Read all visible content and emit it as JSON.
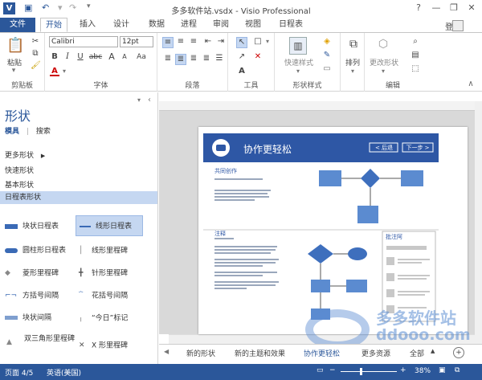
{
  "title_bar": {
    "app_icon": "V",
    "title": "多多软件站.vsdx - Visio Professional",
    "help": "?",
    "minimize": "—",
    "restore": "❐",
    "close": "✕"
  },
  "tabs": [
    {
      "label": "文件"
    },
    {
      "label": "开始"
    },
    {
      "label": "插入"
    },
    {
      "label": "设计"
    },
    {
      "label": "数据"
    },
    {
      "label": "进程"
    },
    {
      "label": "审阅"
    },
    {
      "label": "视图"
    },
    {
      "label": "日程表"
    }
  ],
  "login_label": "登录",
  "ribbon": {
    "clipboard": {
      "label": "剪贴板",
      "paste": "粘贴"
    },
    "font": {
      "label": "字体",
      "font_name": "Calibri",
      "font_size": "12pt"
    },
    "paragraph": {
      "label": "段落"
    },
    "tools": {
      "label": "工具"
    },
    "shape_styles": {
      "label": "形状样式",
      "quick_styles": "快速样式"
    },
    "arrange": {
      "label": "排列"
    },
    "edit": {
      "label": "编辑",
      "change_shape": "更改形状"
    }
  },
  "shapes_pane": {
    "title": "形状",
    "tab_stencils": "模具",
    "tab_search": "搜索",
    "menu": [
      "更多形状",
      "快速形状",
      "基本形状",
      "日程表形状"
    ],
    "items": [
      {
        "label": "块状日程表"
      },
      {
        "label": "线形日程表"
      },
      {
        "label": "圆柱形日程表"
      },
      {
        "label": "线形里程碑"
      },
      {
        "label": "菱形里程碑"
      },
      {
        "label": "针形里程碑"
      },
      {
        "label": "方括号间隔"
      },
      {
        "label": "花括号间隔"
      },
      {
        "label": "块状间隔"
      },
      {
        "label": "“今日”标记"
      },
      {
        "label": "双三角形里程碑"
      },
      {
        "label": "X 形里程碑"
      }
    ]
  },
  "slide": {
    "header": "协作更轻松",
    "back": "< 后退",
    "next": "下一步 >",
    "section1_title": "共同创作",
    "section2_title": "注释",
    "comments_title": "批注阿"
  },
  "page_tabs": [
    "新的形状",
    "新的主题和效果",
    "协作更轻松",
    "更多资源",
    "全部"
  ],
  "status": {
    "page": "页面 4/5",
    "language": "英语(美国)",
    "zoom": "38%"
  },
  "watermark": {
    "text1": "多多软件站",
    "text2": "ddooo.com"
  },
  "colors": {
    "accent": "#2b579a",
    "slide_header": "#2e57a5",
    "selected": "#c5d7f1"
  }
}
